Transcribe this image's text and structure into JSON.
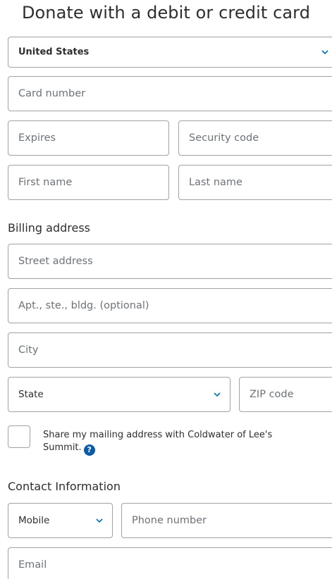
{
  "header": {
    "title": "Donate with a debit or credit card"
  },
  "form": {
    "country": {
      "value": "United States",
      "icon": "chevron-down-icon"
    },
    "card_number": {
      "placeholder": "Card number"
    },
    "expires": {
      "placeholder": "Expires"
    },
    "security_code": {
      "placeholder": "Security code"
    },
    "first_name": {
      "placeholder": "First name"
    },
    "last_name": {
      "placeholder": "Last name"
    },
    "billing_label": "Billing address",
    "street": {
      "placeholder": "Street address"
    },
    "apt": {
      "placeholder": "Apt., ste., bldg. (optional)"
    },
    "city": {
      "placeholder": "City"
    },
    "state": {
      "value": "State",
      "icon": "chevron-down-icon"
    },
    "zip": {
      "placeholder": "ZIP code"
    },
    "share_checkbox": {
      "checked": false,
      "label": "Share my mailing address with Coldwater of Lee's Summit.",
      "help_icon": "question-mark-icon",
      "help_glyph": "?"
    },
    "contact_label": "Contact Information",
    "phone_type": {
      "value": "Mobile",
      "icon": "chevron-down-icon"
    },
    "phone": {
      "placeholder": "Phone number"
    },
    "email": {
      "placeholder": "Email"
    }
  },
  "colors": {
    "border": "#9da3a6",
    "placeholder": "#6c7378",
    "text": "#2c2e2f",
    "accent": "#0a5ba8",
    "chevron": "#0070ba"
  }
}
